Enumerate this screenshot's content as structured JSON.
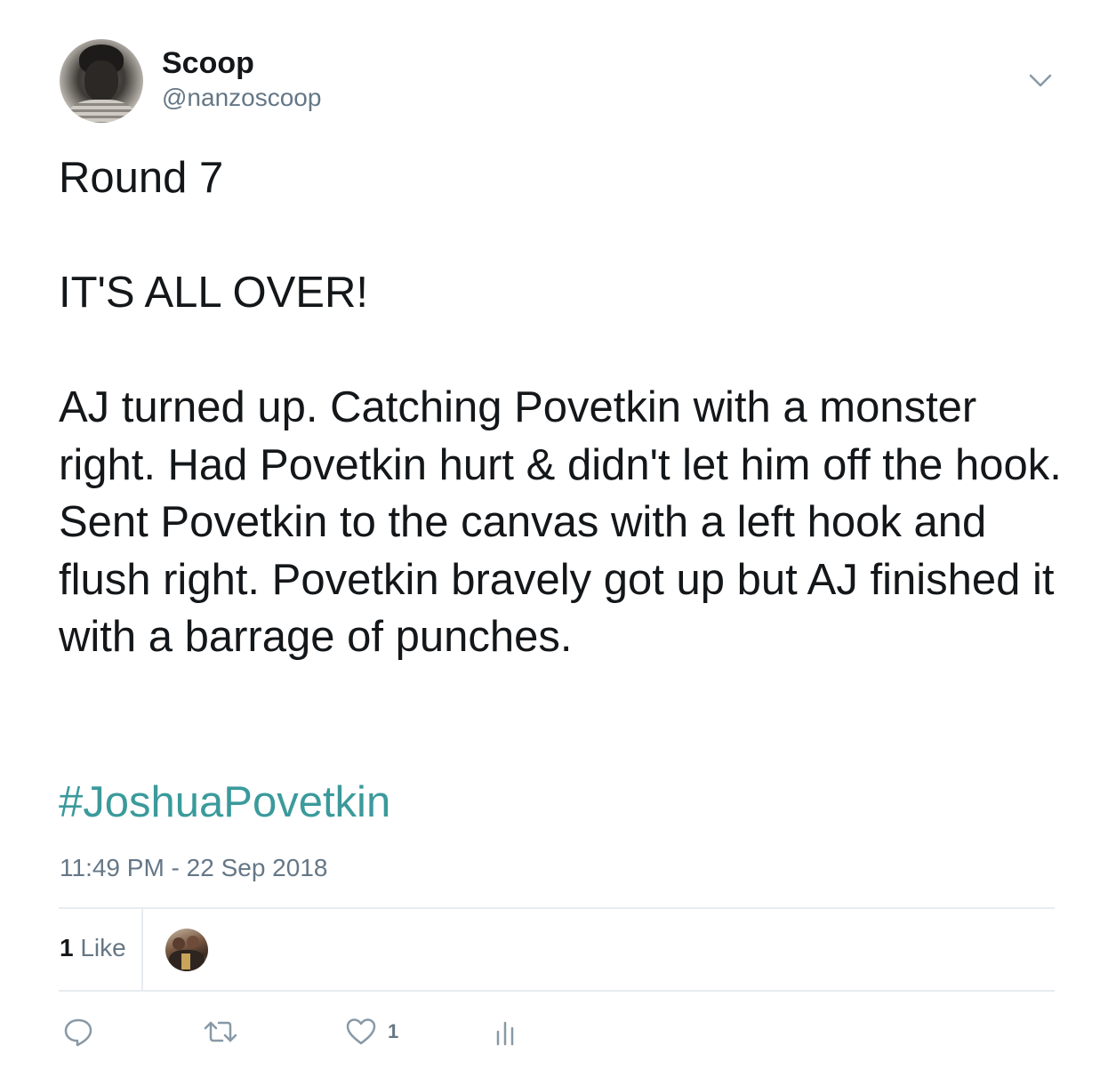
{
  "author": {
    "display_name": "Scoop",
    "handle": "@nanzoscoop"
  },
  "tweet": {
    "text": "Round 7\n\nIT'S ALL OVER!\n\nAJ turned up. Catching Povetkin with a monster right. Had Povetkin hurt & didn't let him off the hook. Sent Povetkin to the canvas with a left hook and flush right. Povetkin bravely got up but AJ finished it with a barrage of punches.",
    "hashtag": "#JoshuaPovetkin",
    "timestamp": "11:49 PM - 22 Sep 2018"
  },
  "stats": {
    "like_count": "1",
    "like_label": " Like"
  },
  "actions": {
    "like_count": "1"
  },
  "icons": {
    "caret": "chevron-down-icon",
    "reply": "reply-icon",
    "retweet": "retweet-icon",
    "like": "heart-icon",
    "analytics": "analytics-icon"
  },
  "colors": {
    "hashtag": "#3b9a9b",
    "secondary_text": "#657786",
    "primary_text": "#14171a",
    "divider": "#e6ecf0"
  }
}
